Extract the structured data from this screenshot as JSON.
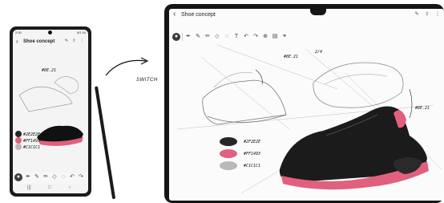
{
  "phone": {
    "status_time": "2:30",
    "status_right": "5G 44",
    "title": "Shoe concept",
    "back_icon": "chevron-left-icon",
    "header_icons": [
      "pen-mode-icon",
      "share-icon",
      "more-icon"
    ],
    "color_labels": [
      "#2E2E2E",
      "#FF1493",
      "#C1C1C1"
    ],
    "annotation_labels": [
      "#8E.21"
    ],
    "nav_icons": [
      "recent-apps-icon",
      "home-icon",
      "back-icon"
    ]
  },
  "switch_text": "SWITCH",
  "tablet": {
    "title": "Shoe concept",
    "header_icons": [
      "pen-mode-icon",
      "share-icon",
      "more-icon"
    ],
    "toolbar_icons": [
      "pen-tool-icon",
      "fountain-pen-icon",
      "marker-icon",
      "pencil-icon",
      "eraser-icon",
      "lasso-icon",
      "text-icon",
      "undo-icon",
      "redo-icon",
      "insert-icon",
      "shape-icon",
      "more-tools-icon"
    ],
    "annotation_labels": [
      "#8E.21",
      "2/4",
      "#8E.21"
    ],
    "color_swatches": [
      {
        "hex": "#262626",
        "label": "#2F2E2E"
      },
      {
        "hex": "#e0607e",
        "label": "#FF1493"
      },
      {
        "hex": "#b9b9b9",
        "label": "#C1C1C1"
      }
    ]
  }
}
